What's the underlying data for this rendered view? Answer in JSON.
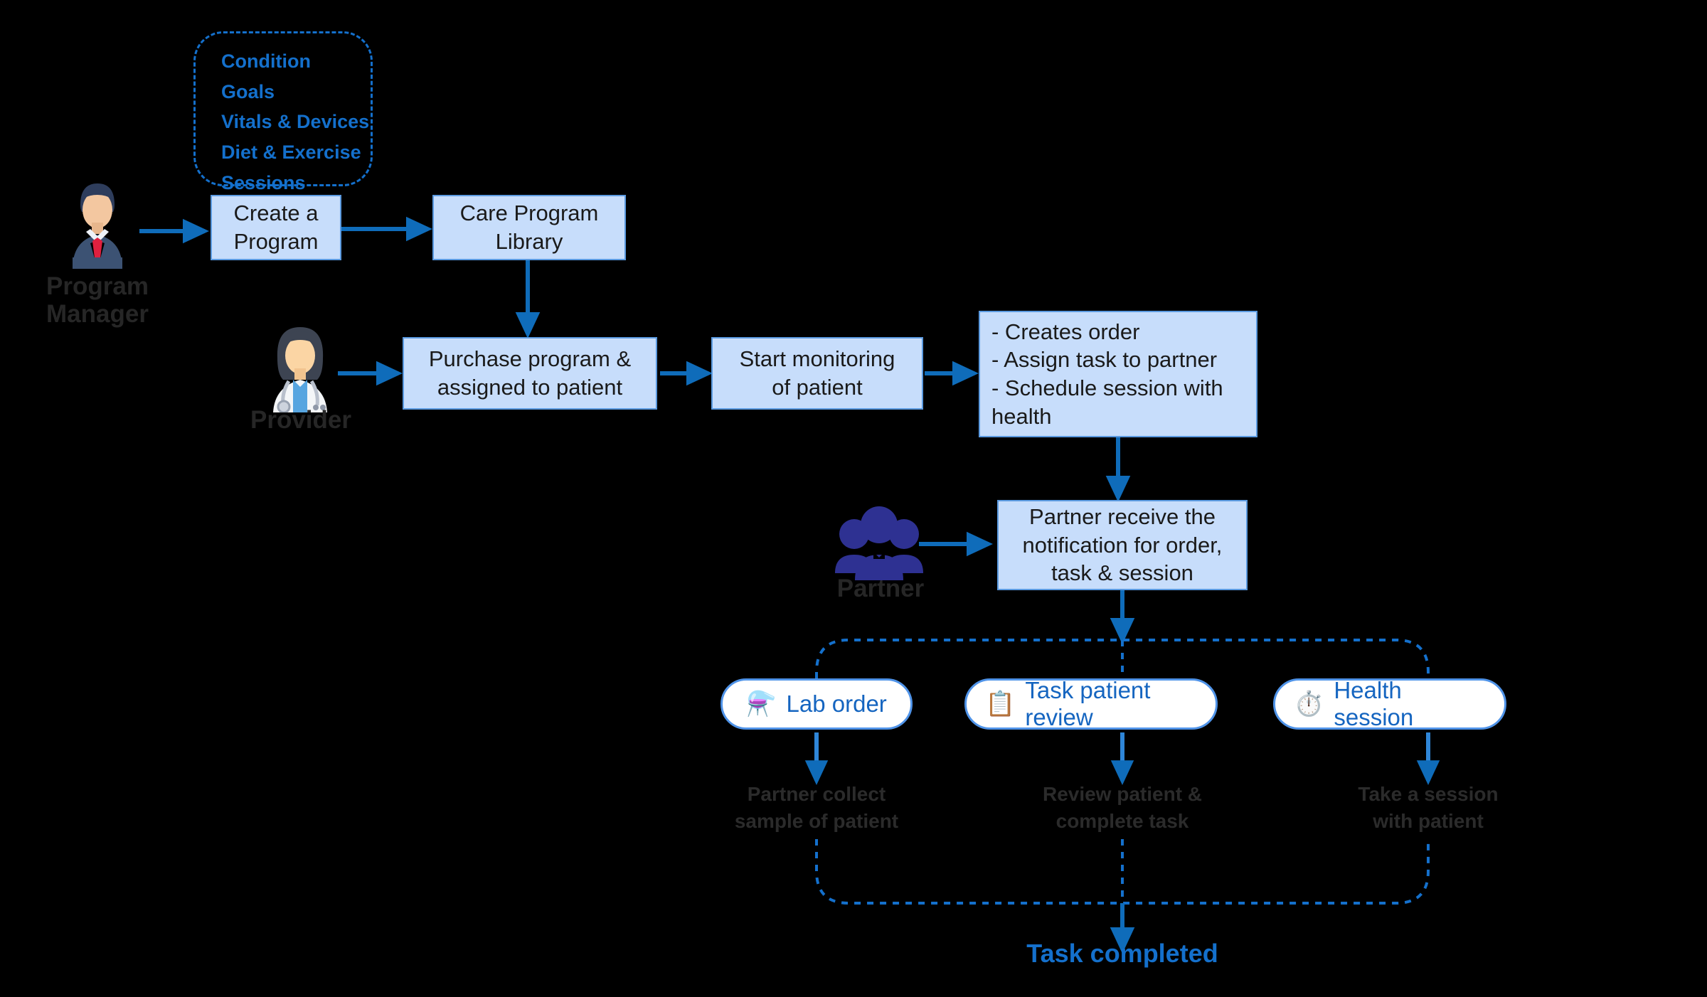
{
  "theme": {
    "background": "#000000",
    "box_fill": "#c7ddfb",
    "box_border": "#5b9ae0",
    "arrow_color": "#0f6cba",
    "dash_color": "#1470cc",
    "accent_blue": "#1470cc",
    "pill_text": "#1565c0",
    "pill_border": "#4f93e8",
    "actor_label_color": "#262626",
    "caption_color": "#2b2b2b"
  },
  "program_attributes": {
    "title": "",
    "items": [
      "Condition",
      "Goals",
      "Vitals & Devices",
      "Diet & Exercise",
      "Sessions"
    ]
  },
  "actors": [
    {
      "id": "program-manager",
      "label_line1": "Program",
      "label_line2": "Manager",
      "icon": "businessman-avatar-icon"
    },
    {
      "id": "provider",
      "label_line1": "Provider",
      "label_line2": "",
      "icon": "female-doctor-avatar-icon"
    },
    {
      "id": "partner",
      "label_line1": "Partner",
      "label_line2": "",
      "icon": "people-group-icon"
    }
  ],
  "boxes": {
    "create_program": {
      "line1": "Create a",
      "line2": "Program"
    },
    "care_program_library": {
      "line1": "Care Program",
      "line2": "Library"
    },
    "purchase_program": {
      "line1": "Purchase program &",
      "line2": "assigned to patient"
    },
    "start_monitoring": {
      "line1": "Start monitoring",
      "line2": "of patient"
    },
    "provider_actions": {
      "line1": "- Creates order",
      "line2": "- Assign task to partner",
      "line3": "- Schedule session with",
      "line4": "   health"
    },
    "partner_notification": {
      "line1": "Partner receive the",
      "line2": "notification for order,",
      "line3": "task & session"
    }
  },
  "branches": [
    {
      "id": "lab-order",
      "pill_label": "Lab order",
      "pill_icon": "lab-flask-icon",
      "pill_emoji": "⚗️",
      "caption_line1": "Partner collect",
      "caption_line2": "sample of patient"
    },
    {
      "id": "task-patient-review",
      "pill_label": "Task patient review",
      "pill_icon": "clipboard-checklist-icon",
      "pill_emoji": "📋",
      "caption_line1": "Review patient &",
      "caption_line2": "complete task"
    },
    {
      "id": "health-session",
      "pill_label": "Health session",
      "pill_icon": "session-clock-person-icon",
      "pill_emoji": "⏱️",
      "caption_line1": "Take a session",
      "caption_line2": "with patient"
    }
  ],
  "terminal": {
    "label": "Task completed"
  }
}
